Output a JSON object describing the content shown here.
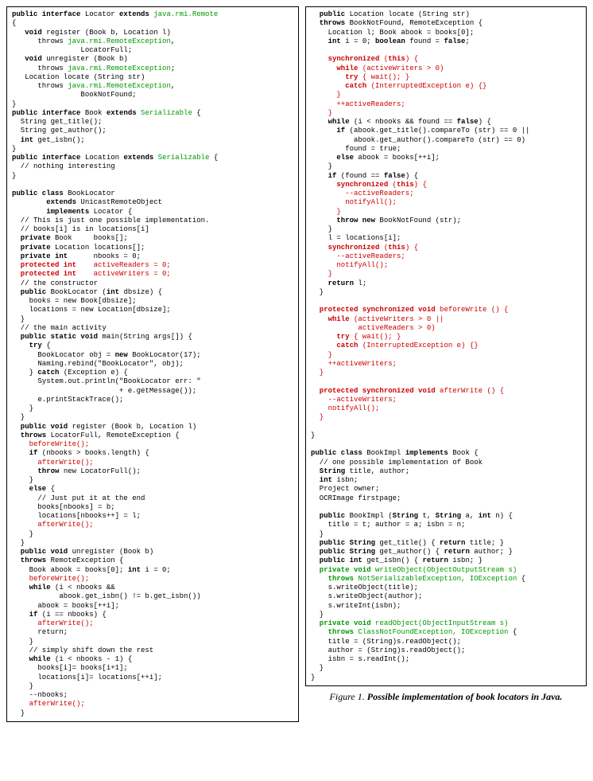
{
  "caption": {
    "fignum": "Figure 1.",
    "title": "Possible implementation of book locators in Java."
  },
  "left": {
    "l01a": "public interface",
    "l01b": " Locator ",
    "l01c": "extends",
    "l01d": " java.rmi.Remote",
    "l02": "{",
    "l03a": "   void",
    "l03b": " register (Book b, Location l)",
    "l04a": "      throws ",
    "l04b": "java.rmi.RemoteException",
    "l04c": ",",
    "l05": "                LocatorFull;",
    "l06a": "   void",
    "l06b": " unregister (Book b)",
    "l07a": "      throws ",
    "l07b": "java.rmi.RemoteException",
    "l07c": ";",
    "l08": "   Location locate (String str)",
    "l09a": "      throws ",
    "l09b": "java.rmi.RemoteException",
    "l09c": ",",
    "l10": "                BookNotFound;",
    "l11": "}",
    "l12a": "public interface",
    "l12b": " Book ",
    "l12c": "extends",
    "l12d": " Serializable",
    "l12e": " {",
    "l13": "  String get_title();",
    "l14": "  String get_author();",
    "l15a": "  int",
    "l15b": " get_isbn();",
    "l16": "}",
    "l17a": "public interface",
    "l17b": " Location ",
    "l17c": "extends",
    "l17d": " Serializable",
    "l17e": " {",
    "l18": "  // nothing interesting",
    "l19": "}",
    "l20": "",
    "l21a": "public class",
    "l21b": " BookLocator",
    "l22a": "        extends",
    "l22b": " UnicastRemoteObject",
    "l23a": "        implements",
    "l23b": " Locator {",
    "l24": "  // This is just one possible implementation.",
    "l25": "  // books[i] is in locations[i]",
    "l26a": "  private",
    "l26b": " Book     books[];",
    "l27a": "  private",
    "l27b": " Location locations[];",
    "l28a": "  private int",
    "l28b": "      nbooks = 0;",
    "l29a": "  protected int",
    "l29b": "    activeReaders = 0;",
    "l30a": "  protected int",
    "l30b": "    activeWriters = 0;",
    "l31": "  // the constructor",
    "l32a": "  public",
    "l32b": " BookLocator (",
    "l32c": "int",
    "l32d": " dbsize) {",
    "l33": "    books = new Book[dbsize];",
    "l34": "    locations = new Location[dbsize];",
    "l35": "  }",
    "l36": "  // the main activity",
    "l37a": "  public static void",
    "l37b": " main(String args[]) {",
    "l38a": "    try",
    "l38b": " {",
    "l39a": "      BookLocator obj = ",
    "l39b": "new",
    "l39c": " BookLocator(17);",
    "l40": "      Naming.rebind(\"BookLocator\", obj);",
    "l41a": "    } ",
    "l41b": "catch",
    "l41c": " (Exception e) {",
    "l42": "      System.out.println(\"BookLocator err: \"",
    "l43": "                         + e.getMessage());",
    "l44": "      e.printStackTrace();",
    "l45": "    }",
    "l46": "  }",
    "l47a": "  public void",
    "l47b": " register (Book b, Location l)",
    "l48a": "  throws",
    "l48b": " LocatorFull, RemoteException {",
    "l49": "    beforeWrite();",
    "l50a": "    if",
    "l50b": " (nbooks > books.length) {",
    "l51": "      afterWrite();",
    "l52a": "      throw",
    "l52b": " new LocatorFull();",
    "l53": "    }",
    "l54a": "    else",
    "l54b": " {",
    "l55": "      // Just put it at the end",
    "l56": "      books[nbooks] = b;",
    "l57": "      locations[nbooks++] = l;",
    "l58": "      afterWrite();",
    "l59": "    }",
    "l60": "  }",
    "l61a": "  public void",
    "l61b": " unregister (Book b)",
    "l62a": "  throws",
    "l62b": " RemoteException {",
    "l63a": "    Book abook = books[0]; ",
    "l63b": "int",
    "l63c": " i = 0;",
    "l64": "    beforeWrite();",
    "l65a": "    while",
    "l65b": " (i < nbooks &&",
    "l66": "           abook.get_isbn() != b.get_isbn())",
    "l67": "      abook = books[++i];",
    "l68a": "    if",
    "l68b": " (i == nbooks) {",
    "l69": "      afterWrite();",
    "l70": "      return;",
    "l71": "    }",
    "l72": "    // simply shift down the rest",
    "l73a": "    while",
    "l73b": " (i < nbooks - 1) {",
    "l74": "      books[i]= books[i+1];",
    "l75": "      locations[i]= locations[++i];",
    "l76": "    }",
    "l77": "    --nbooks;",
    "l78": "    afterWrite();",
    "l79": "  }"
  },
  "right": {
    "r01a": "  public",
    "r01b": " Location locate (String str)",
    "r02a": "  throws",
    "r02b": " BookNotFound, RemoteException {",
    "r03": "    Location l; Book abook = books[0];",
    "r04a": "    int",
    "r04b": " i = 0; ",
    "r04c": "boolean",
    "r04d": " found = ",
    "r04e": "false",
    "r04f": ";",
    "r05": "",
    "r06a": "    synchronized",
    "r06b": " (",
    "r06c": "this",
    "r06d": ") {",
    "r07a": "      while",
    "r07b": " (activeWriters > 0)",
    "r08a": "        try",
    "r08b": " { wait(); }",
    "r09a": "        catch",
    "r09b": " (InterruptedException e) {}",
    "r10": "      }",
    "r11": "      ++activeReaders;",
    "r12": "    }",
    "r13a": "    while",
    "r13b": " (i < nbooks && found == ",
    "r13c": "false",
    "r13d": ") {",
    "r14a": "      if",
    "r14b": " (abook.get_title().compareTo (str) == 0 ||",
    "r15": "          abook.get_author().compareTo (str) == 0)",
    "r16": "        found = true;",
    "r17a": "      else",
    "r17b": " abook = books[++i];",
    "r18": "    }",
    "r19a": "    if",
    "r19b": " (found == ",
    "r19c": "false",
    "r19d": ") {",
    "r20a": "      synchronized",
    "r20b": " (",
    "r20c": "this",
    "r20d": ") {",
    "r21": "        --activeReaders;",
    "r22": "        notifyAll();",
    "r23": "      }",
    "r24a": "      throw new",
    "r24b": " BookNotFound (str);",
    "r25": "    }",
    "r26": "    l = locations[i];",
    "r27a": "    synchronized",
    "r27b": " (",
    "r27c": "this",
    "r27d": ") {",
    "r28": "      --activeReaders;",
    "r29": "      notifyAll();",
    "r30": "    }",
    "r31a": "    return",
    "r31b": " l;",
    "r32": "  }",
    "r33": "",
    "r34a": "  protected synchronized void",
    "r34b": " beforeWrite () {",
    "r35a": "    while",
    "r35b": " (activeWriters > 0 ||",
    "r36": "           activeReaders > 0)",
    "r37a": "      try",
    "r37b": " { wait(); }",
    "r38a": "      catch",
    "r38b": " (InterruptedException e) {}",
    "r39": "    }",
    "r40": "    ++activeWriters;",
    "r41": "  }",
    "r42": "",
    "r43a": "  protected synchronized void",
    "r43b": " afterWrite () {",
    "r44": "    --activeWriters;",
    "r45": "    notifyAll();",
    "r46": "  }",
    "r47": "",
    "r48": "}",
    "r49": "",
    "r50a": "public class",
    "r50b": " BookImpl ",
    "r50c": "implements",
    "r50d": " Book {",
    "r51": "  // one possible implementation of Book",
    "r52a": "  String",
    "r52b": " title, author;",
    "r53a": "  int",
    "r53b": " isbn;",
    "r54": "  Project owner;",
    "r55": "  OCRImage firstpage;",
    "r56": "",
    "r57a": "  public",
    "r57b": " BookImpl (",
    "r57c": "String",
    "r57d": " t, ",
    "r57e": "String",
    "r57f": " a, ",
    "r57g": "int",
    "r57h": " n) {",
    "r58": "    title = t; author = a; isbn = n;",
    "r59": "  }",
    "r60a": "  public String",
    "r60b": " get_title() { ",
    "r60c": "return",
    "r60d": " title; }",
    "r61a": "  public String",
    "r61b": " get_author() { ",
    "r61c": "return",
    "r61d": " author; }",
    "r62a": "  public int",
    "r62b": " get_isbn() { ",
    "r62c": "return",
    "r62d": " isbn; }",
    "r63a": "  private void",
    "r63b": " writeObject(ObjectOutputStream s)",
    "r64a": "    throws",
    "r64b": " NotSerializableException, IOException",
    "r64c": " {",
    "r65": "    s.writeObject(title);",
    "r66": "    s.writeObject(author);",
    "r67": "    s.writeInt(isbn);",
    "r68": "  }",
    "r69a": "  private void",
    "r69b": " readObject(ObjectInputStream s)",
    "r70a": "    throws",
    "r70b": " ClassNotFoundException, IOException",
    "r70c": " {",
    "r71": "    title = (String)s.readObject();",
    "r72": "    author = (String)s.readObject();",
    "r73": "    isbn = s.readInt();",
    "r74": "  }",
    "r75": "}"
  }
}
